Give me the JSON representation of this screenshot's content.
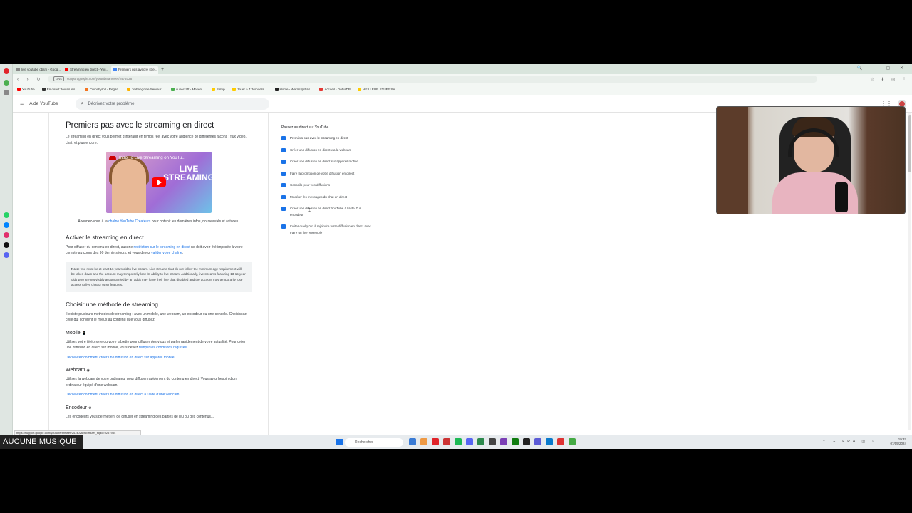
{
  "tabs": [
    {
      "label": "live youtube obsm - Goog...",
      "color": "#888888"
    },
    {
      "label": "Streaming en direct - You...",
      "color": "#ff0000"
    },
    {
      "label": "Premiers pas avec le stre...",
      "color": "#4285f4"
    }
  ],
  "address": {
    "badge": "DNS",
    "url": "support.google.com/youtube/answer/2474026"
  },
  "bookmarks": [
    {
      "label": "YouTube",
      "color": "#ff0000"
    },
    {
      "label": "En direct: toutes les...",
      "color": "#333333"
    },
    {
      "label": "Crunchyroll - Regar...",
      "color": "#f47521"
    },
    {
      "label": "Véhengoine Serveur...",
      "color": "#ffb400"
    },
    {
      "label": "cubecraft - Mesen...",
      "color": "#4caf50"
    },
    {
      "label": "Setup",
      "color": "#ffcc00"
    },
    {
      "label": "Jouer à 7 Wonders ...",
      "color": "#ffcc00"
    },
    {
      "label": "Home - WarmUp Fall...",
      "color": "#222222"
    },
    {
      "label": "Accueil - DofusDB",
      "color": "#e53935"
    },
    {
      "label": "MEILLEUR STUFF SA...",
      "color": "#ffcc00"
    }
  ],
  "header": {
    "brand": "Aide YouTube",
    "search_placeholder": "Décrivez votre problème"
  },
  "article": {
    "title": "Premiers pas avec le streaming en direct",
    "intro": "Le streaming en direct vous permet d'interagir en temps réel avec votre audience de différentes façons : flux vidéo, chat, et plus encore.",
    "video_title": "Intro To Live Streaming on YouTu...",
    "video_overlay": "LIVE STREAMING",
    "subscribe_prefix": "Abonnez-vous à la ",
    "subscribe_link": "chaîne YouTube Créateurs",
    "subscribe_suffix": " pour obtenir les dernières infos, nouveautés et astuces.",
    "section1_title": "Activer le streaming en direct",
    "section1_p_a": "Pour diffuser du contenu en direct, aucune ",
    "section1_link1": "restriction sur le streaming en direct",
    "section1_p_b": " ne doit avoir été imposée à votre compte au cours des 90 derniers jours, et vous devez ",
    "section1_link2": "valider votre chaîne",
    "section1_p_c": ".",
    "note_label": "Note:",
    "note_text": " You must be at least 16 years old to live stream. Live streams that do not follow the minimum age requirement will be taken down and the account may temporarily lose its ability to live stream. Additionally, live streams featuring 13-15 year olds who are not visibly accompanied by an adult may have their live chat disabled and the account may temporarily lose access to live chat or other features.",
    "section2_title": "Choisir une méthode de streaming",
    "section2_p": "Il existe plusieurs méthodes de streaming : avec un mobile, une webcam, un encodeur ou une console. Choisissez celle qui convient le mieux au contenu que vous diffusez.",
    "mobile_title": "Mobile",
    "mobile_icon": "📱",
    "mobile_p_a": "Utilisez votre téléphone ou votre tablette pour diffuser des vlogs et parler rapidement de votre actualité. Pour créer une diffusion en direct sur mobile, vous devez ",
    "mobile_link": "remplir les conditions requises",
    "mobile_p_b": ".",
    "mobile_more": "Découvrez comment créer une diffusion en direct sur appareil mobile.",
    "webcam_title": "Webcam",
    "webcam_icon": "◉",
    "webcam_p": "Utilisez la webcam de votre ordinateur pour diffuser rapidement du contenu en direct. Vous avez besoin d'un ordinateur équipé d'une webcam.",
    "webcam_more": "Découvrez comment créer une diffusion en direct à l'aide d'une webcam.",
    "encoder_title": "Encodeur",
    "encoder_icon": "⚙",
    "encoder_p": "Les encodeurs vous permettent de diffuser en streaming des parties de jeu ou des contenus..."
  },
  "sidebar": {
    "title": "Passez au direct sur YouTube",
    "items": [
      "Premiers pas avec le streaming en direct",
      "Créer une diffusion en direct via la webcam",
      "Créer une diffusion en direct sur appareil mobile",
      "Faire la promotion de votre diffusion en direct",
      "Conseils pour vos diffusions",
      "Modérer les messages du chat en direct",
      "Créer une diffusion en direct YouTube à l'aide d'un encodeur",
      "Inviter quelqu'un à rejoindre votre diffusion en direct avec Faire un live ensemble"
    ]
  },
  "status_url": "https://support.google.com/youtube/answer/2474026?hl=fr&ref_topic=9257984",
  "taskbar": {
    "music": "AUCUNE MUSIQUE",
    "search": "Rechercher",
    "tray_lang": "FRA",
    "tray_time": "19:37",
    "tray_date": "07/05/2024"
  },
  "colors": {
    "accent": "#1a73e8",
    "brand_red": "#ff0000"
  }
}
